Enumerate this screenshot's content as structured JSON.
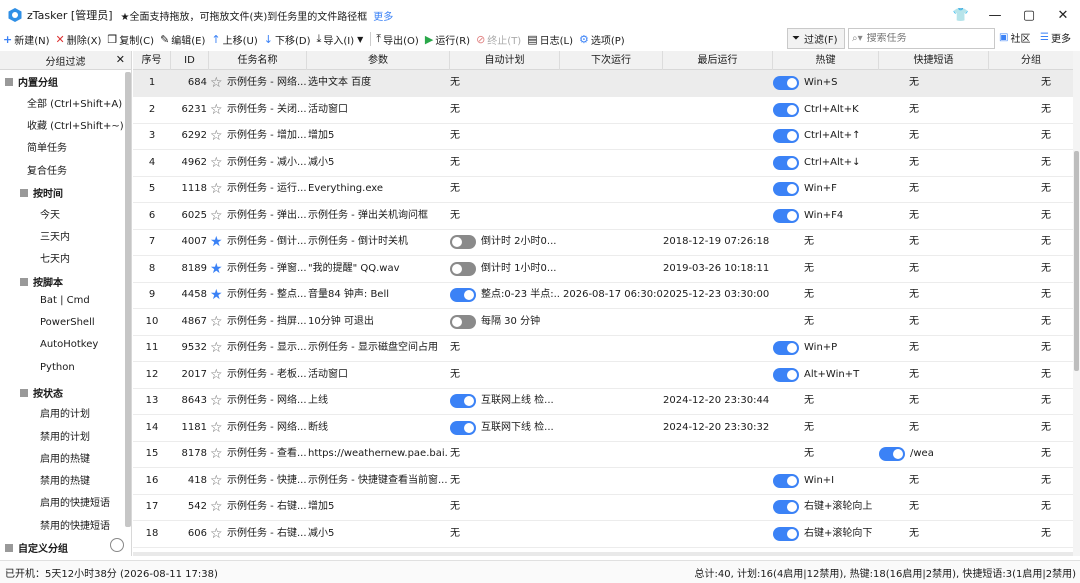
{
  "title_bar": {
    "app_title": "zTasker [管理员]",
    "notice": "★全面支持拖放，可拖放文件(夹)到任务里的文件路径框",
    "more_link": "更多"
  },
  "toolbar": {
    "new": "新建(N)",
    "delete": "删除(X)",
    "copy": "复制(C)",
    "edit": "编辑(E)",
    "up": "上移(U)",
    "down": "下移(D)",
    "import": "导入(I)",
    "export": "导出(O)",
    "run": "运行(R)",
    "stop": "终止(T)",
    "log": "日志(L)",
    "options": "选项(P)",
    "filter": "过滤(F)",
    "search_placeholder": "搜索任务",
    "community": "社区",
    "more": "更多"
  },
  "sidebar": {
    "header": "分组过滤",
    "builtin_group": "内置分组",
    "builtin_items": [
      "全部 (Ctrl+Shift+A)",
      "收藏 (Ctrl+Shift+~)",
      "简单任务",
      "复合任务"
    ],
    "by_time": "按时间",
    "time_items": [
      "今天",
      "三天内",
      "七天内"
    ],
    "by_script": "按脚本",
    "script_items": [
      "Bat | Cmd",
      "PowerShell",
      "AutoHotkey",
      "Python"
    ],
    "by_status": "按状态",
    "status_items": [
      "启用的计划",
      "禁用的计划",
      "启用的热键",
      "禁用的热键",
      "启用的快捷短语",
      "禁用的快捷短语"
    ],
    "custom_group": "自定义分组"
  },
  "table": {
    "columns": [
      "序号",
      "ID",
      "任务名称",
      "参数",
      "自动计划",
      "下次运行",
      "最后运行",
      "热键",
      "快捷短语",
      "分组"
    ],
    "rows": [
      {
        "idx": "1",
        "id": "684",
        "fav": false,
        "name": "示例任务 - 网络...",
        "param": "选中文本 百度",
        "sched_toggle": "none",
        "sched": "无",
        "next": "",
        "last": "",
        "hot_toggle": "on",
        "hot": "Win+S",
        "phrase_toggle": "none",
        "phrase": "无",
        "group": "无"
      },
      {
        "idx": "2",
        "id": "6231",
        "fav": false,
        "name": "示例任务 - 关闭...",
        "param": "活动窗口",
        "sched_toggle": "none",
        "sched": "无",
        "next": "",
        "last": "",
        "hot_toggle": "on",
        "hot": "Ctrl+Alt+K",
        "phrase_toggle": "none",
        "phrase": "无",
        "group": "无"
      },
      {
        "idx": "3",
        "id": "6292",
        "fav": false,
        "name": "示例任务 - 增加...",
        "param": "增加5",
        "sched_toggle": "none",
        "sched": "无",
        "next": "",
        "last": "",
        "hot_toggle": "on",
        "hot": "Ctrl+Alt+↑",
        "phrase_toggle": "none",
        "phrase": "无",
        "group": "无"
      },
      {
        "idx": "4",
        "id": "4962",
        "fav": false,
        "name": "示例任务 - 减小...",
        "param": "减小5",
        "sched_toggle": "none",
        "sched": "无",
        "next": "",
        "last": "",
        "hot_toggle": "on",
        "hot": "Ctrl+Alt+↓",
        "phrase_toggle": "none",
        "phrase": "无",
        "group": "无"
      },
      {
        "idx": "5",
        "id": "1118",
        "fav": false,
        "name": "示例任务 - 运行...",
        "param": "Everything.exe",
        "sched_toggle": "none",
        "sched": "无",
        "next": "",
        "last": "",
        "hot_toggle": "on",
        "hot": "Win+F",
        "phrase_toggle": "none",
        "phrase": "无",
        "group": "无"
      },
      {
        "idx": "6",
        "id": "6025",
        "fav": false,
        "name": "示例任务 - 弹出...",
        "param": "示例任务 - 弹出关机询问框",
        "sched_toggle": "none",
        "sched": "无",
        "next": "",
        "last": "",
        "hot_toggle": "on",
        "hot": "Win+F4",
        "phrase_toggle": "none",
        "phrase": "无",
        "group": "无"
      },
      {
        "idx": "7",
        "id": "4007",
        "fav": true,
        "name": "示例任务 - 倒计...",
        "param": "示例任务 - 倒计时关机",
        "sched_toggle": "off",
        "sched": "倒计时 2小时0...",
        "next": "",
        "last": "2018-12-19 07:26:18",
        "hot_toggle": "none",
        "hot": "无",
        "phrase_toggle": "none",
        "phrase": "无",
        "group": "无"
      },
      {
        "idx": "8",
        "id": "8189",
        "fav": true,
        "name": "示例任务 - 弹窗...",
        "param": "\"我的提醒\" QQ.wav",
        "sched_toggle": "off",
        "sched": "倒计时 1小时0...",
        "next": "",
        "last": "2019-03-26 10:18:11",
        "hot_toggle": "none",
        "hot": "无",
        "phrase_toggle": "none",
        "phrase": "无",
        "group": "无"
      },
      {
        "idx": "9",
        "id": "4458",
        "fav": true,
        "name": "示例任务 - 整点...",
        "param": "音量84 钟声: Bell",
        "sched_toggle": "on",
        "sched": "整点:0-23 半点:...",
        "next": "2026-08-17 06:30:00...",
        "last": "2025-12-23 03:30:00",
        "hot_toggle": "none",
        "hot": "无",
        "phrase_toggle": "none",
        "phrase": "无",
        "group": "无"
      },
      {
        "idx": "10",
        "id": "4867",
        "fav": false,
        "name": "示例任务 - 挡屏...",
        "param": "10分钟 可退出",
        "sched_toggle": "off",
        "sched": "每隔 30 分钟",
        "next": "",
        "last": "",
        "hot_toggle": "none",
        "hot": "无",
        "phrase_toggle": "none",
        "phrase": "无",
        "group": "无"
      },
      {
        "idx": "11",
        "id": "9532",
        "fav": false,
        "name": "示例任务 - 显示...",
        "param": "示例任务 - 显示磁盘空间占用",
        "sched_toggle": "none",
        "sched": "无",
        "next": "",
        "last": "",
        "hot_toggle": "on",
        "hot": "Win+P",
        "phrase_toggle": "none",
        "phrase": "无",
        "group": "无"
      },
      {
        "idx": "12",
        "id": "2017",
        "fav": false,
        "name": "示例任务 - 老板...",
        "param": "活动窗口",
        "sched_toggle": "none",
        "sched": "无",
        "next": "",
        "last": "",
        "hot_toggle": "on",
        "hot": "Alt+Win+T",
        "phrase_toggle": "none",
        "phrase": "无",
        "group": "无"
      },
      {
        "idx": "13",
        "id": "8643",
        "fav": false,
        "name": "示例任务 - 网络...",
        "param": "上线",
        "sched_toggle": "on",
        "sched": "互联网上线 检...",
        "next": "",
        "last": "2024-12-20 23:30:44",
        "hot_toggle": "none",
        "hot": "无",
        "phrase_toggle": "none",
        "phrase": "无",
        "group": "无"
      },
      {
        "idx": "14",
        "id": "1181",
        "fav": false,
        "name": "示例任务 - 网络...",
        "param": "断线",
        "sched_toggle": "on",
        "sched": "互联网下线 检...",
        "next": "",
        "last": "2024-12-20 23:30:32",
        "hot_toggle": "none",
        "hot": "无",
        "phrase_toggle": "none",
        "phrase": "无",
        "group": "无"
      },
      {
        "idx": "15",
        "id": "8178",
        "fav": false,
        "name": "示例任务 - 查看...",
        "param": "https://weathernew.pae.bai...",
        "sched_toggle": "none",
        "sched": "无",
        "next": "",
        "last": "",
        "hot_toggle": "none",
        "hot": "无",
        "phrase_toggle": "on",
        "phrase": "/wea",
        "group": "无"
      },
      {
        "idx": "16",
        "id": "418",
        "fav": false,
        "name": "示例任务 - 快捷...",
        "param": "示例任务 - 快捷键查看当前窗...",
        "sched_toggle": "none",
        "sched": "无",
        "next": "",
        "last": "",
        "hot_toggle": "on",
        "hot": "Win+I",
        "phrase_toggle": "none",
        "phrase": "无",
        "group": "无"
      },
      {
        "idx": "17",
        "id": "542",
        "fav": false,
        "name": "示例任务 - 右键...",
        "param": "增加5",
        "sched_toggle": "none",
        "sched": "无",
        "next": "",
        "last": "",
        "hot_toggle": "on",
        "hot": "右键+滚轮向上",
        "phrase_toggle": "none",
        "phrase": "无",
        "group": "无"
      },
      {
        "idx": "18",
        "id": "606",
        "fav": false,
        "name": "示例任务 - 右键...",
        "param": "减小5",
        "sched_toggle": "none",
        "sched": "无",
        "next": "",
        "last": "",
        "hot_toggle": "on",
        "hot": "右键+滚轮向下",
        "phrase_toggle": "none",
        "phrase": "无",
        "group": "无"
      }
    ]
  },
  "status_bar": {
    "uptime": "已开机：5天12小时38分 (2026-08-11 17:38)",
    "summary": "总计:40, 计划:16(4启用|12禁用), 热键:18(16启用|2禁用), 快捷短语:3(1启用|2禁用)"
  },
  "colors": {
    "accent": "#3b82f6",
    "toggle_off": "#8a8a8a",
    "selected_row": "#ececec"
  }
}
